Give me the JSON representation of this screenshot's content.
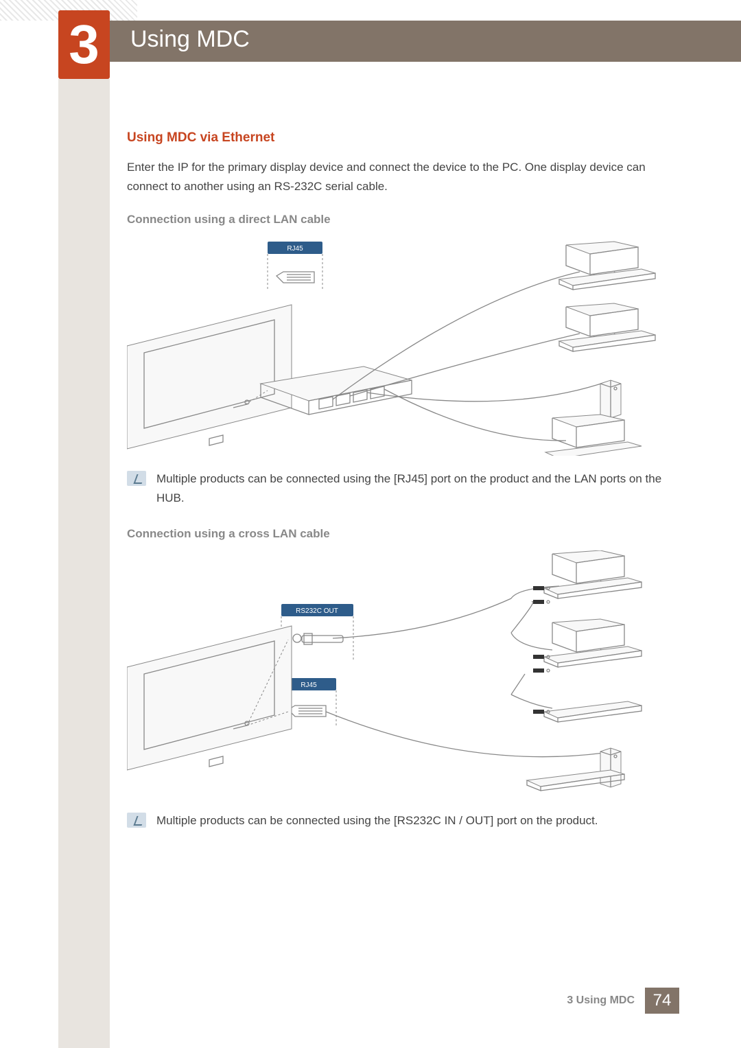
{
  "chapter": {
    "number": "3",
    "title": "Using MDC"
  },
  "section": {
    "title": "Using MDC via Ethernet",
    "intro": "Enter the IP for the primary display device and connect the device to the PC. One display device can connect to another using an RS-232C serial cable."
  },
  "subsection1": {
    "title": "Connection using a direct LAN cable",
    "diagram_label_rj45": "RJ45",
    "note": "Multiple products can be connected using the [RJ45] port on the product and the LAN ports on the HUB."
  },
  "subsection2": {
    "title": "Connection using a cross LAN cable",
    "diagram_label_rs232c": "RS232C OUT",
    "diagram_label_rj45": "RJ45",
    "note": "Multiple products can be connected using the [RS232C IN / OUT] port on the product."
  },
  "footer": {
    "text": "3 Using MDC",
    "page": "74"
  }
}
